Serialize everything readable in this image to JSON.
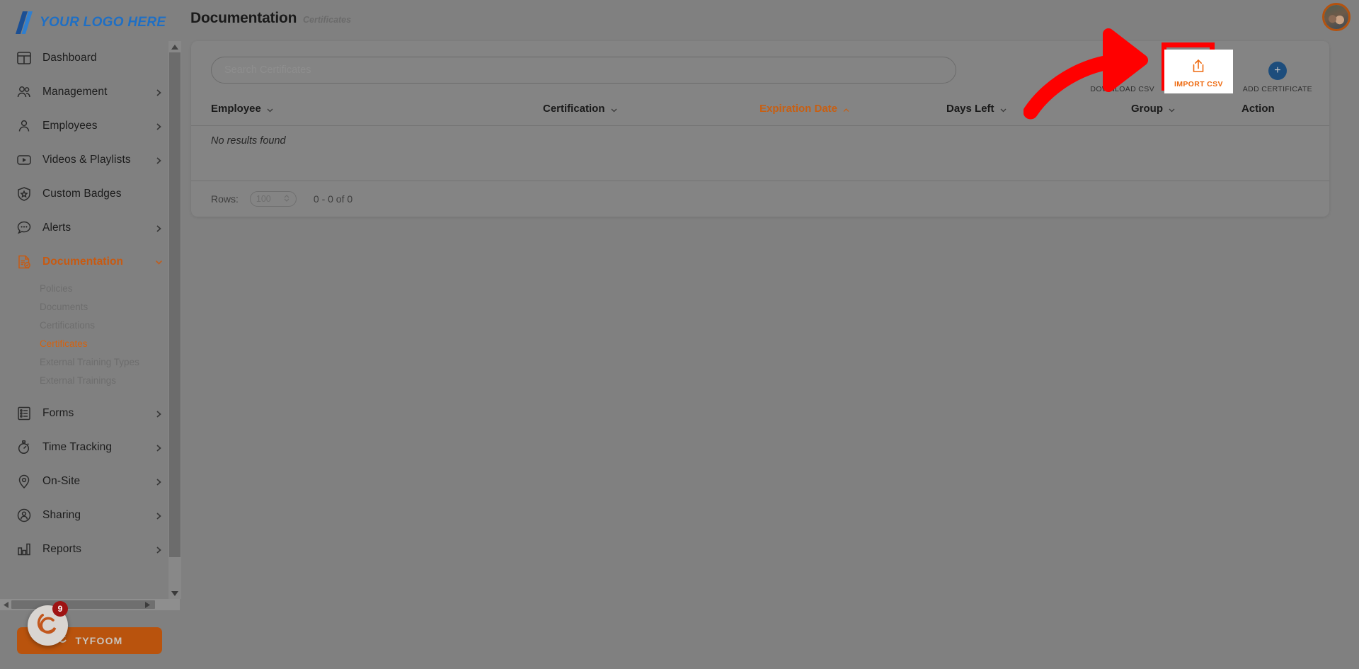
{
  "brand": {
    "logo_text": "YOUR LOGO HERE",
    "logo_color": "#1f6fc4",
    "accent_color": "#d4620f"
  },
  "sidebar": {
    "items": [
      {
        "label": "Dashboard",
        "icon": "dashboard-icon",
        "has_chevron": false,
        "active": false
      },
      {
        "label": "Management",
        "icon": "users-icon",
        "has_chevron": true,
        "active": false
      },
      {
        "label": "Employees",
        "icon": "user-icon",
        "has_chevron": true,
        "active": false
      },
      {
        "label": "Videos & Playlists",
        "icon": "video-play-icon",
        "has_chevron": true,
        "active": false
      },
      {
        "label": "Custom Badges",
        "icon": "shield-star-icon",
        "has_chevron": false,
        "active": false
      },
      {
        "label": "Alerts",
        "icon": "chat-bubble-icon",
        "has_chevron": true,
        "active": false
      },
      {
        "label": "Documentation",
        "icon": "document-check-icon",
        "has_chevron": true,
        "active": true
      },
      {
        "label": "Forms",
        "icon": "form-list-icon",
        "has_chevron": true,
        "active": false
      },
      {
        "label": "Time Tracking",
        "icon": "stopwatch-icon",
        "has_chevron": true,
        "active": false
      },
      {
        "label": "On-Site",
        "icon": "map-pin-icon",
        "has_chevron": true,
        "active": false
      },
      {
        "label": "Sharing",
        "icon": "share-user-icon",
        "has_chevron": true,
        "active": false
      },
      {
        "label": "Reports",
        "icon": "bar-chart-icon",
        "has_chevron": true,
        "active": false
      }
    ],
    "documentation_subitems": [
      {
        "label": "Policies",
        "active": false
      },
      {
        "label": "Documents",
        "active": false
      },
      {
        "label": "Certifications",
        "active": false
      },
      {
        "label": "Certificates",
        "active": true
      },
      {
        "label": "External Training Types",
        "active": false
      },
      {
        "label": "External Trainings",
        "active": false
      }
    ],
    "tyfoom": {
      "label": "TYFOOM",
      "badge_count": "9"
    }
  },
  "header": {
    "title": "Documentation",
    "breadcrumb": "Certificates"
  },
  "search": {
    "placeholder": "Search Certificates",
    "value": ""
  },
  "toolbar": {
    "download_csv_label": "DOWNLOAD CSV",
    "import_csv_label": "IMPORT CSV",
    "add_certificate_label": "ADD CERTIFICATE",
    "import_highlight_color": "#ff0000",
    "import_accent_color": "#ee6a10",
    "add_button_color": "#1d4d7c"
  },
  "table": {
    "columns": [
      {
        "label": "Employee",
        "sortable": true,
        "sorted": false,
        "direction": "down"
      },
      {
        "label": "Certification",
        "sortable": true,
        "sorted": false,
        "direction": "down"
      },
      {
        "label": "Expiration Date",
        "sortable": true,
        "sorted": true,
        "direction": "up"
      },
      {
        "label": "Days Left",
        "sortable": true,
        "sorted": false,
        "direction": "down"
      },
      {
        "label": "Group",
        "sortable": true,
        "sorted": false,
        "direction": "down"
      },
      {
        "label": "Action",
        "sortable": false,
        "sorted": false,
        "direction": ""
      }
    ],
    "rows": [],
    "empty_message": "No results found"
  },
  "pagination": {
    "rows_label": "Rows:",
    "rows_value": "100",
    "range_label": "0 - 0 of 0"
  },
  "annotation": {
    "arrow_color": "#ff0000",
    "points_to": "IMPORT CSV"
  }
}
